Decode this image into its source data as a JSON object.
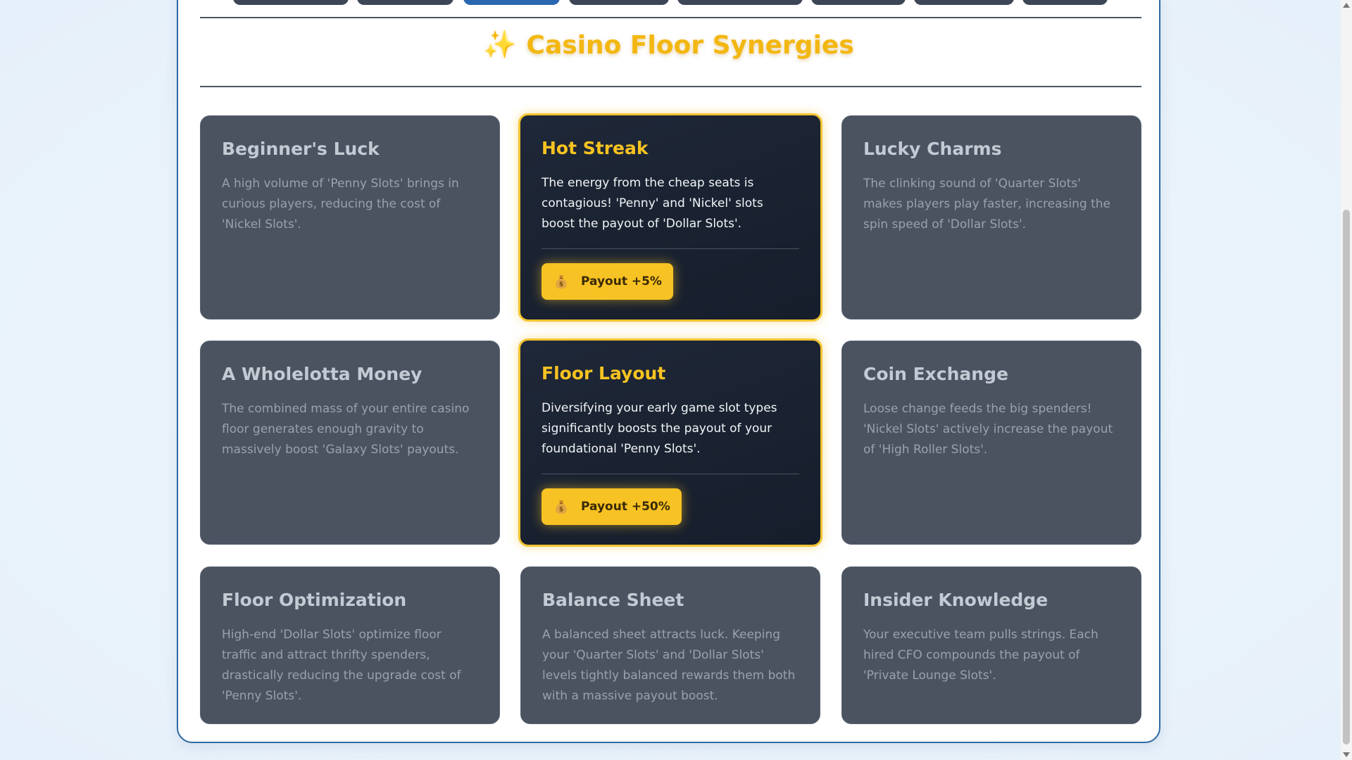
{
  "heading": {
    "icon": "sparkles-icon",
    "title": "Casino Floor Synergies"
  },
  "colors": {
    "accent": "#f7c223",
    "card_bg": "#4b5361",
    "active_card_bg": "#1a2232",
    "panel_border": "#2d6aa3"
  },
  "synergies": [
    {
      "title": "Beginner's Luck",
      "description": "A high volume of 'Penny Slots' brings in curious players, reducing the cost of 'Nickel Slots'.",
      "active": false
    },
    {
      "title": "Hot Streak",
      "description": "The energy from the cheap seats is contagious! 'Penny' and 'Nickel' slots boost the payout of 'Dollar Slots'.",
      "active": true,
      "badge_icon": "money-bag-icon",
      "badge": "Payout +5%"
    },
    {
      "title": "Lucky Charms",
      "description": "The clinking sound of 'Quarter Slots' makes players play faster, increasing the spin speed of 'Dollar Slots'.",
      "active": false
    },
    {
      "title": "A Wholelotta Money",
      "description": "The combined mass of your entire casino floor generates enough gravity to massively boost 'Galaxy Slots' payouts.",
      "active": false
    },
    {
      "title": "Floor Layout",
      "description": "Diversifying your early game slot types significantly boosts the payout of your foundational 'Penny Slots'.",
      "active": true,
      "badge_icon": "money-bag-icon",
      "badge": "Payout +50%"
    },
    {
      "title": "Coin Exchange",
      "description": "Loose change feeds the big spenders! 'Nickel Slots' actively increase the payout of 'High Roller Slots'.",
      "active": false
    },
    {
      "title": "Floor Optimization",
      "description": "High-end 'Dollar Slots' optimize floor traffic and attract thrifty spenders, drastically reducing the upgrade cost of 'Penny Slots'.",
      "active": false
    },
    {
      "title": "Balance Sheet",
      "description": "A balanced sheet attracts luck. Keeping your 'Quarter Slots' and 'Dollar Slots' levels tightly balanced rewards them both with a massive payout boost.",
      "active": false
    },
    {
      "title": "Insider Knowledge",
      "description": "Your executive team pulls strings. Each hired CFO compounds the payout of 'Private Lounge Slots'.",
      "active": false
    }
  ]
}
